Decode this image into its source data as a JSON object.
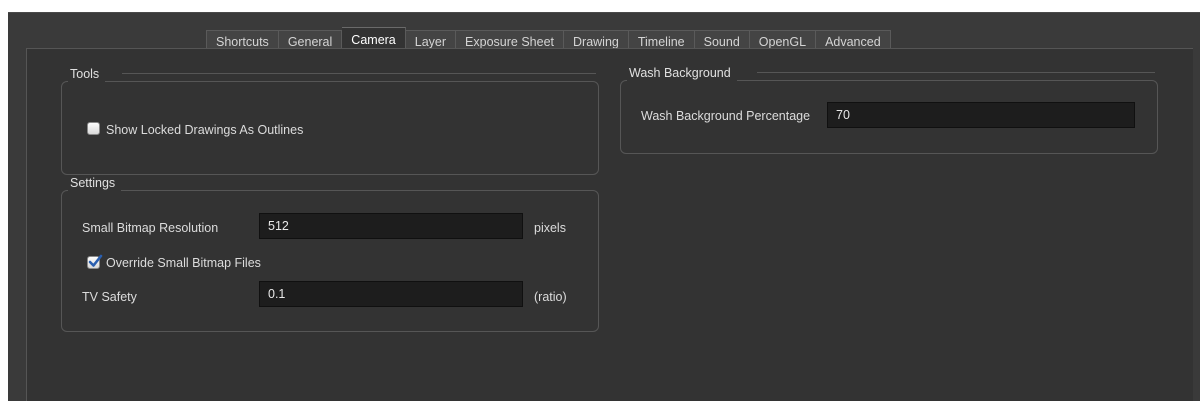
{
  "tabs": [
    {
      "label": "Shortcuts",
      "active": false
    },
    {
      "label": "General",
      "active": false
    },
    {
      "label": "Camera",
      "active": true
    },
    {
      "label": "Layer",
      "active": false
    },
    {
      "label": "Exposure Sheet",
      "active": false
    },
    {
      "label": "Drawing",
      "active": false
    },
    {
      "label": "Timeline",
      "active": false
    },
    {
      "label": "Sound",
      "active": false
    },
    {
      "label": "OpenGL",
      "active": false
    },
    {
      "label": "Advanced",
      "active": false
    }
  ],
  "tools": {
    "title": "Tools",
    "show_locked_label": "Show Locked Drawings As Outlines",
    "show_locked_checked": false
  },
  "settings": {
    "title": "Settings",
    "bitmap_resolution_label": "Small Bitmap Resolution",
    "bitmap_resolution_value": "512",
    "bitmap_resolution_unit": "pixels",
    "override_label": "Override Small Bitmap Files",
    "override_checked": true,
    "tv_safety_label": "TV Safety",
    "tv_safety_value": "0.1",
    "tv_safety_unit": "(ratio)"
  },
  "wash": {
    "title": "Wash Background",
    "percentage_label": "Wash Background Percentage",
    "percentage_value": "70"
  },
  "colors": {
    "background": "#3a3a3a",
    "panel": "#333333",
    "field": "#1d1d1d",
    "check_accent": "#2a5fb0"
  }
}
